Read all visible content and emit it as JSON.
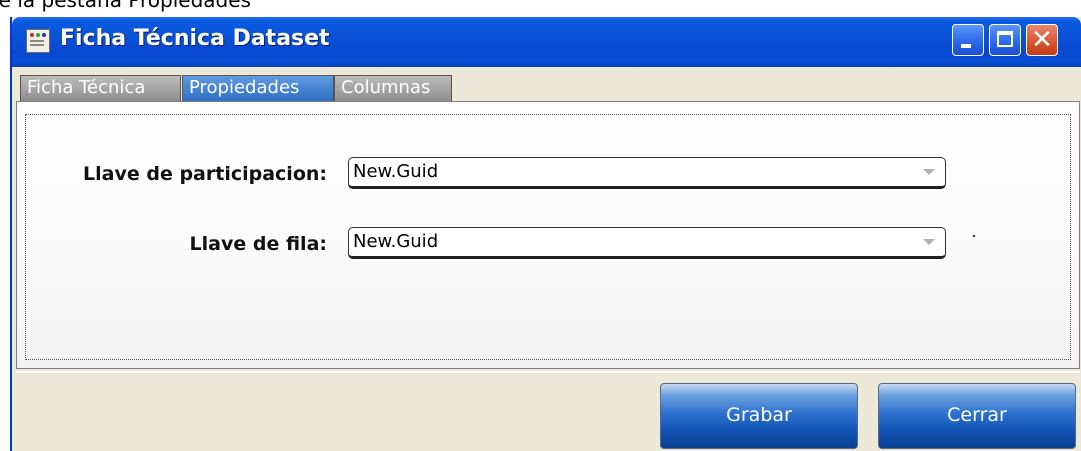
{
  "caption": "ne la pestaña Propiedades",
  "window": {
    "title": "Ficha Técnica Dataset",
    "controls": {
      "minimize": "minimize-icon",
      "maximize": "maximize-icon",
      "close": "✕"
    }
  },
  "tabs": [
    {
      "label": "Ficha Técnica",
      "active": false
    },
    {
      "label": "Propiedades",
      "active": true
    },
    {
      "label": "Columnas",
      "active": false
    }
  ],
  "form": {
    "partition_key_label": "Llave de participacion:",
    "partition_key_value": "New.Guid",
    "row_key_label": "Llave de fila:",
    "row_key_value": "New.Guid"
  },
  "buttons": {
    "save": "Grabar",
    "close": "Cerrar"
  },
  "colors": {
    "titlebar": "#0a52d8",
    "active_tab": "#2f6fc4",
    "button": "#1456b8"
  }
}
